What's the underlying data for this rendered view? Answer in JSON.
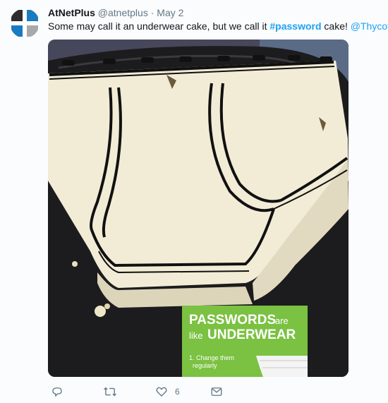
{
  "tweet": {
    "author_name": "AtNetPlus",
    "author_handle": "@atnetplus",
    "separator": "·",
    "date": "May 2",
    "text_before": "Some may call it an underwear cake, but we call it ",
    "hashtag": "#password",
    "text_middle": " cake! ",
    "mention": "@Thycotic"
  },
  "photo": {
    "sign_line1_big": "PASSWORDS",
    "sign_line1_small": "are",
    "sign_line2_small": "like",
    "sign_line2_big": "UNDERWEAR",
    "sign_item_line1": "1. Change them",
    "sign_item_line2": "regularly"
  },
  "actions": {
    "reply_icon": "reply-icon",
    "retweet_icon": "retweet-icon",
    "like_icon": "like-icon",
    "like_count": "6",
    "dm_icon": "direct-message-icon"
  },
  "colors": {
    "link": "#1da1f2",
    "muted": "#657786",
    "sign_green": "#7bc142"
  }
}
